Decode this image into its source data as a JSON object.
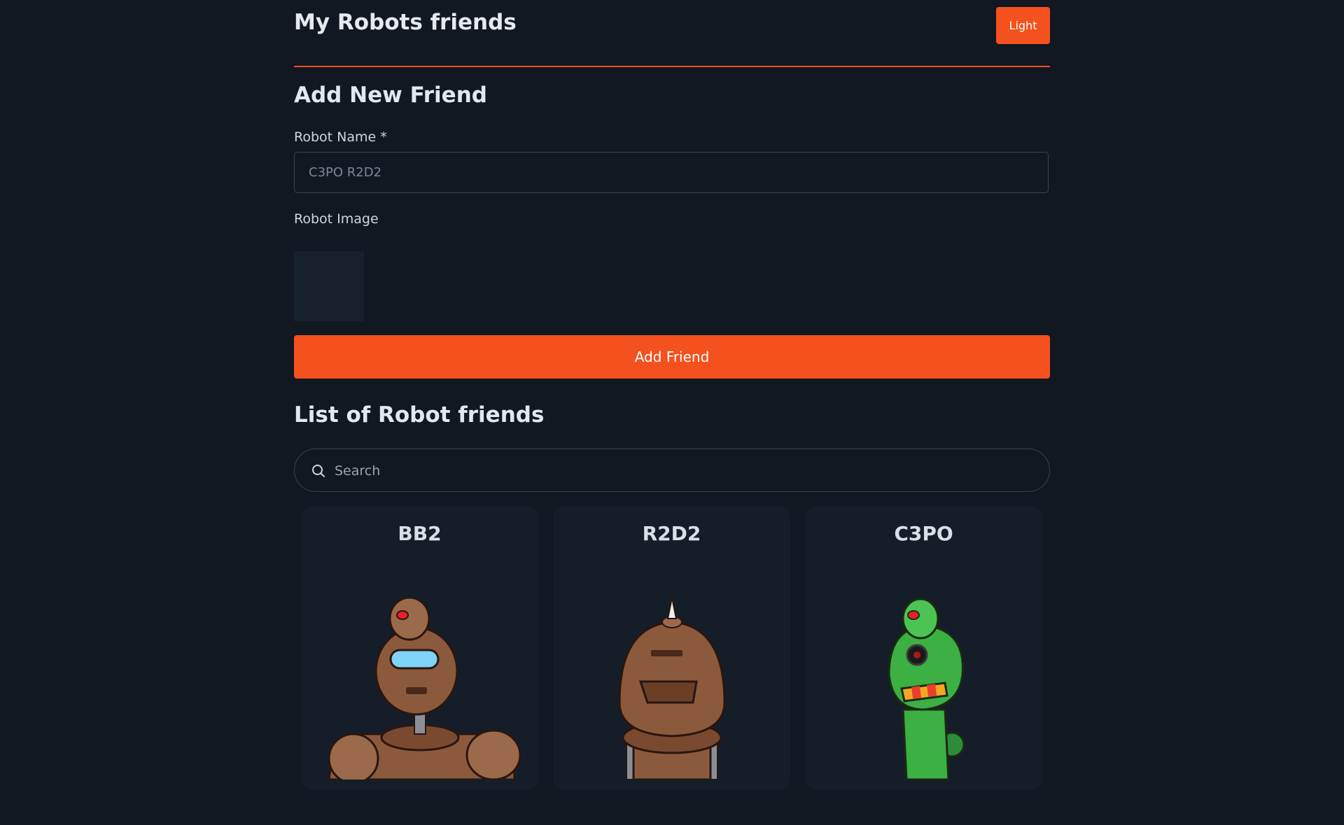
{
  "header": {
    "title": "My Robots friends",
    "theme_button": "Light"
  },
  "form": {
    "title": "Add New Friend",
    "name_label": "Robot Name *",
    "name_placeholder": "C3PO R2D2",
    "image_label": "Robot Image",
    "submit_label": "Add Friend"
  },
  "list": {
    "title": "List of Robot friends",
    "search_placeholder": "Search",
    "robots": [
      {
        "name": "BB2",
        "color": "#8b5a3c"
      },
      {
        "name": "R2D2",
        "color": "#8b5a3c"
      },
      {
        "name": "C3PO",
        "color": "#3cb043"
      }
    ]
  },
  "colors": {
    "accent": "#f4511e",
    "background": "#111821",
    "card": "#151e28"
  }
}
